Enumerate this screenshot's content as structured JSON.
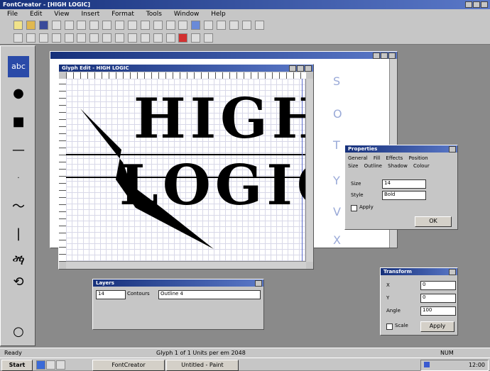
{
  "app": {
    "title": "FontCreator - [HIGH LOGIC]"
  },
  "menu": [
    "File",
    "Edit",
    "View",
    "Insert",
    "Format",
    "Tools",
    "Window",
    "Help"
  ],
  "canvas": {
    "glyph_line1": "HIGH",
    "glyph_line2": "LOGIC"
  },
  "glyph_window": {
    "title": "Glyph Edit - HIGH LOGIC"
  },
  "char_list": {
    "chars": [
      "S",
      "O",
      "T",
      "Y",
      "V",
      "X"
    ]
  },
  "properties_dialog": {
    "title": "Properties",
    "tabs_row1": [
      "General",
      "Fill",
      "Effects",
      "Position"
    ],
    "tabs_row2": [
      "Size",
      "Outline",
      "Shadow",
      "Colour"
    ],
    "field1_label": "Size",
    "field1_value": "14",
    "field2_label": "Style",
    "field2_value": "Bold",
    "checkbox_label": "Apply",
    "ok_label": "OK"
  },
  "bottom_panel": {
    "title": "Layers",
    "value": "14",
    "label": "Contours",
    "dropdown_value": "Outline 4"
  },
  "transform_dialog": {
    "title": "Transform",
    "row1_label": "X",
    "row1_value": "0",
    "row2_label": "Y",
    "row2_value": "0",
    "row3_label": "Angle",
    "row3_value": "100",
    "checkbox_label": "Scale",
    "apply_label": "Apply"
  },
  "status": {
    "left": "Ready",
    "middle": "Glyph 1 of 1  Units per em 2048",
    "right": "NUM"
  },
  "taskbar": {
    "start_label": "Start",
    "items": [
      "FontCreator",
      "Untitled - Paint"
    ],
    "clock": "12:00"
  }
}
